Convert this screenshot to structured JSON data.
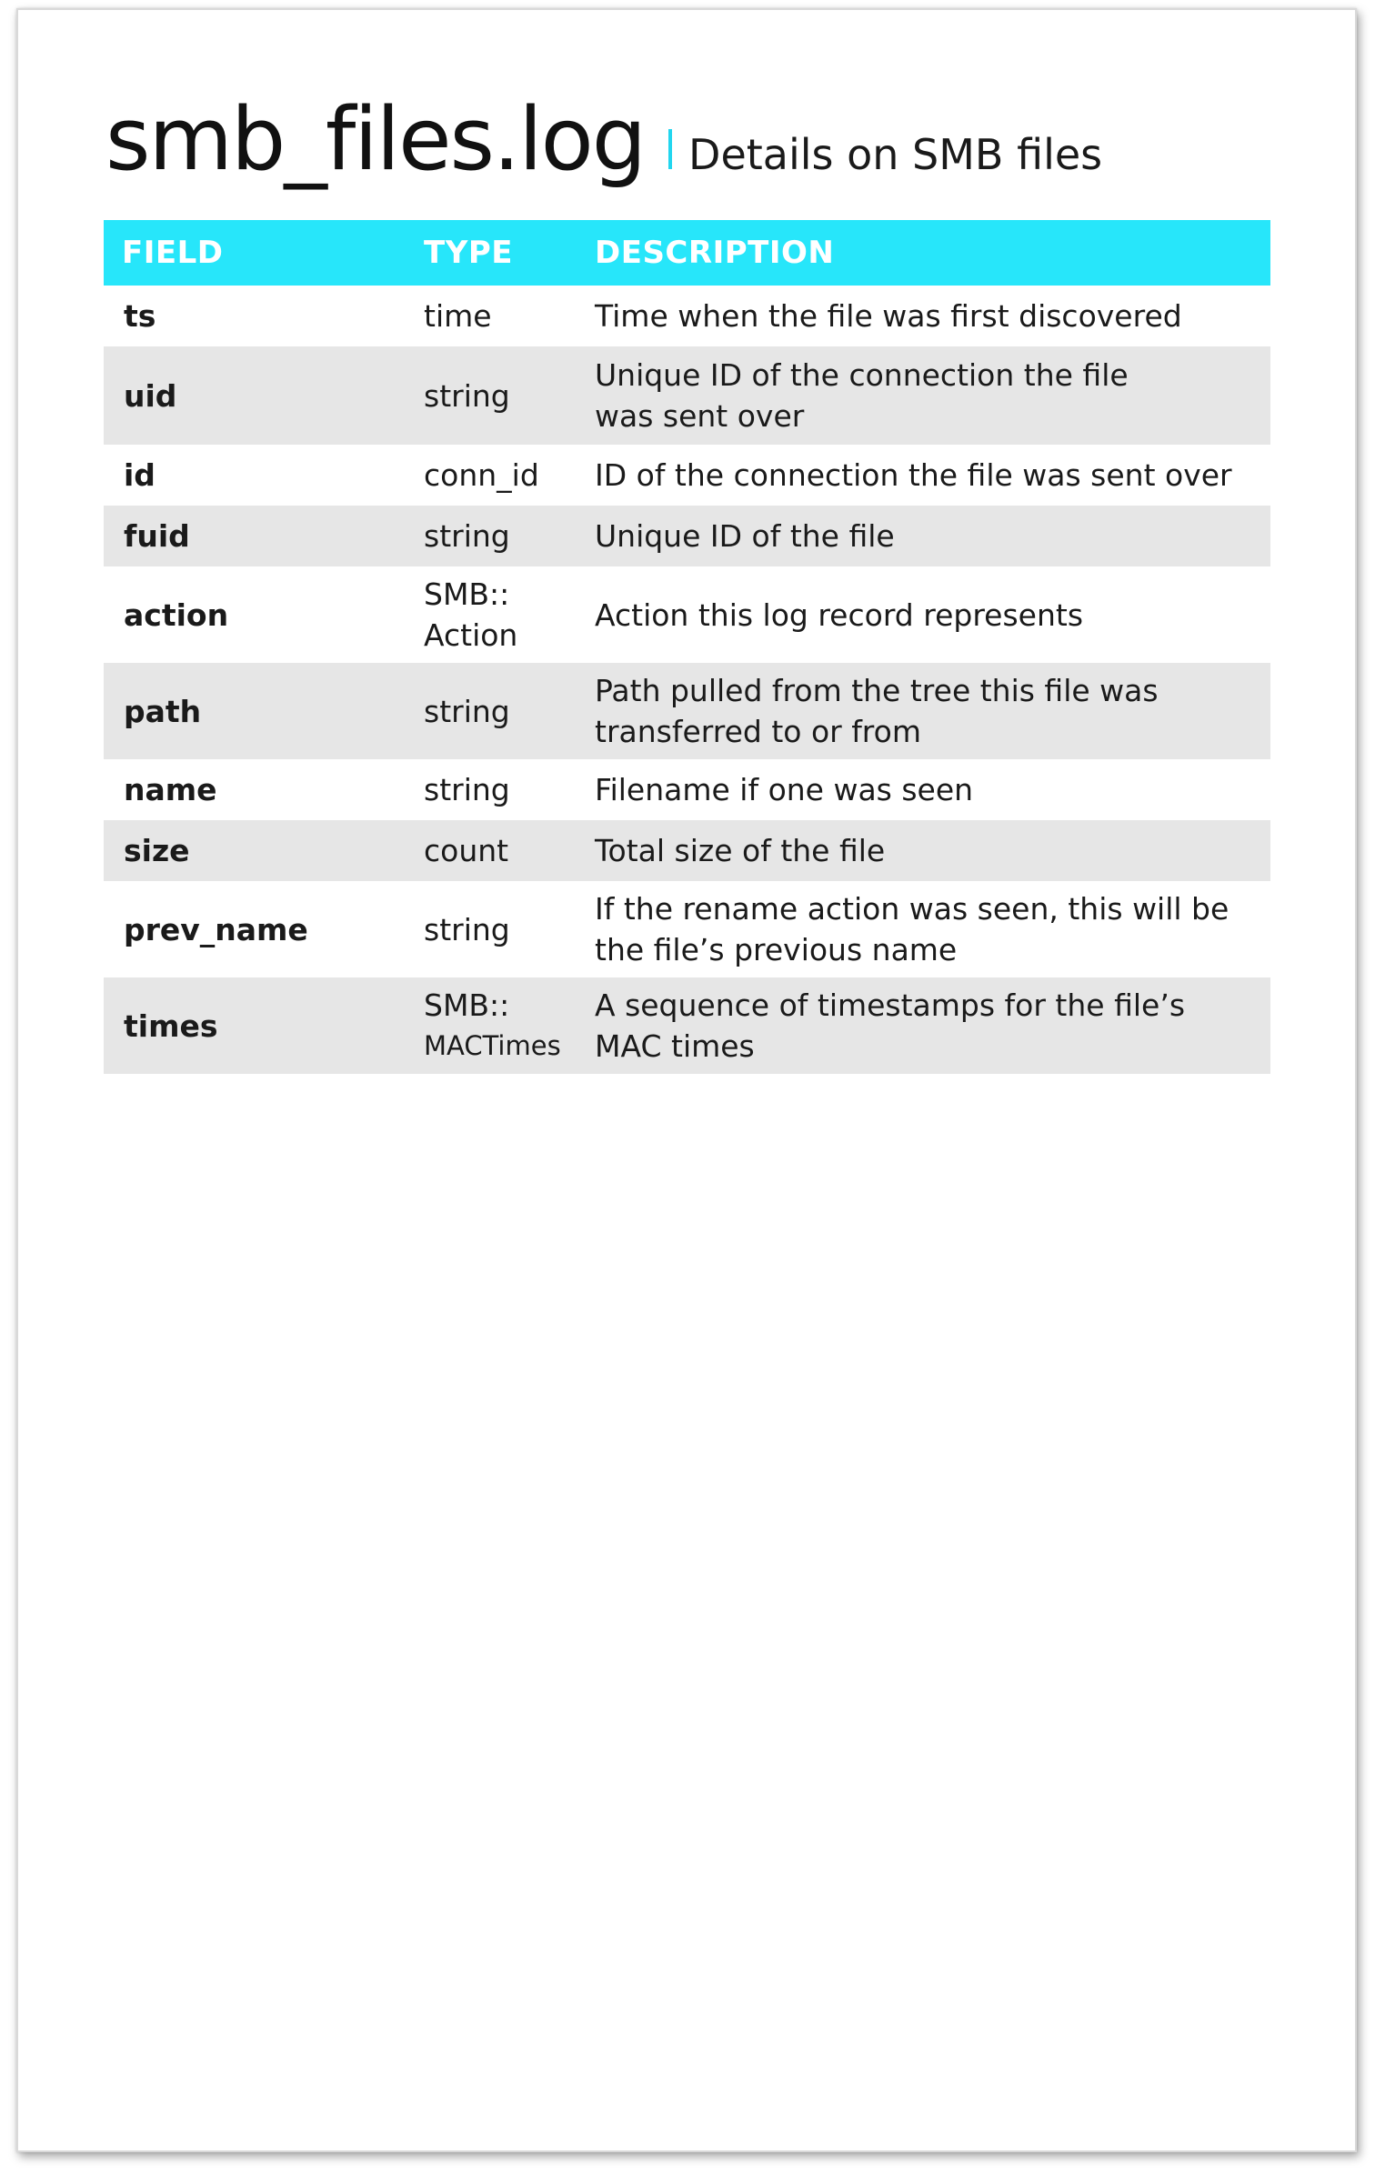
{
  "header": {
    "title": "smb_files.log",
    "subtitle": "Details on SMB files"
  },
  "colors": {
    "accent": "#27e6fa",
    "row_shade": "#e6e6e6"
  },
  "table": {
    "columns": [
      "FIELD",
      "TYPE",
      "DESCRIPTION"
    ],
    "rows": [
      {
        "field": "ts",
        "type": [
          "time"
        ],
        "description": [
          "Time when the file was first discovered"
        ]
      },
      {
        "field": "uid",
        "type": [
          "string"
        ],
        "description": [
          "Unique ID of the connection the file",
          "was sent over"
        ]
      },
      {
        "field": "id",
        "type": [
          "conn_id"
        ],
        "description": [
          "ID of the connection the file was sent over"
        ]
      },
      {
        "field": "fuid",
        "type": [
          "string"
        ],
        "description": [
          "Unique ID of the file"
        ]
      },
      {
        "field": "action",
        "type": [
          "SMB::",
          "Action"
        ],
        "description": [
          "Action this log record represents"
        ]
      },
      {
        "field": "path",
        "type": [
          "string"
        ],
        "description": [
          "Path pulled from the tree this file was",
          "transferred to or from"
        ]
      },
      {
        "field": "name",
        "type": [
          "string"
        ],
        "description": [
          "Filename if one was seen"
        ]
      },
      {
        "field": "size",
        "type": [
          "count"
        ],
        "description": [
          "Total size of the file"
        ]
      },
      {
        "field": "prev_name",
        "type": [
          "string"
        ],
        "description": [
          "If the rename action was seen, this will be",
          "the file’s previous name"
        ]
      },
      {
        "field": "times",
        "type": [
          "SMB::",
          "MACTimes"
        ],
        "description": [
          "A sequence of timestamps for the file’s",
          "MAC times"
        ]
      }
    ]
  }
}
